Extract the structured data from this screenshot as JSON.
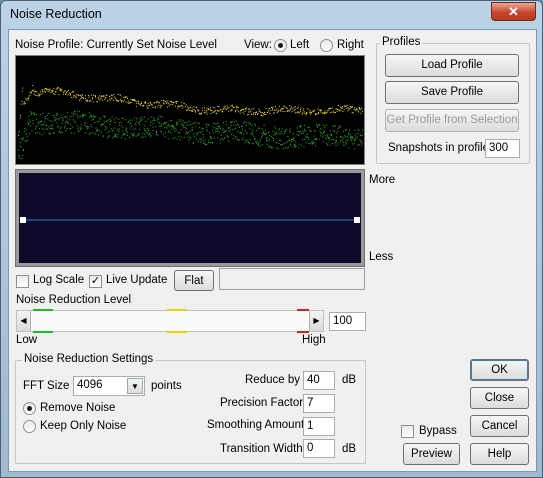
{
  "window": {
    "title": "Noise Reduction",
    "close_glyph": "✕"
  },
  "profile_header": "Noise Profile: Currently Set Noise Level",
  "view": {
    "label": "View:",
    "left": "Left",
    "right": "Right",
    "selected": "Left"
  },
  "profiles": {
    "group_label": "Profiles",
    "load": "Load Profile",
    "save": "Save Profile",
    "get_from_selection": "Get Profile from Selection",
    "snapshots_label": "Snapshots in profile",
    "snapshots_value": "300"
  },
  "curve_editor": {
    "more_label": "More",
    "less_label": "Less",
    "line_color": "#3f6fe0"
  },
  "options": {
    "log_scale": "Log Scale",
    "log_scale_checked": false,
    "live_update": "Live Update",
    "live_update_checked": true,
    "flat": "Flat"
  },
  "reduction_level": {
    "label": "Noise Reduction Level",
    "low": "Low",
    "high": "High",
    "value": "100",
    "markers": {
      "low_color": "#1fbf1f",
      "mid_color": "#e6d400",
      "high_color": "#d42020"
    }
  },
  "settings": {
    "group_label": "Noise Reduction Settings",
    "fft_label": "FFT Size",
    "fft_value": "4096",
    "fft_unit": "points",
    "remove_noise": "Remove Noise",
    "keep_only_noise": "Keep Only Noise",
    "mode_selected": "Remove Noise",
    "reduce_by_label": "Reduce by",
    "reduce_by_value": "40",
    "reduce_by_unit": "dB",
    "precision_label": "Precision Factor",
    "precision_value": "7",
    "smoothing_label": "Smoothing Amount",
    "smoothing_value": "1",
    "transition_label": "Transition Width",
    "transition_value": "0",
    "transition_unit": "dB"
  },
  "actions": {
    "ok": "OK",
    "close": "Close",
    "cancel": "Cancel",
    "help": "Help",
    "preview": "Preview",
    "bypass": "Bypass",
    "bypass_checked": false
  },
  "spectrum_colors": {
    "profile": "#f0e020",
    "signal": "#20c020",
    "background": "#000000"
  }
}
